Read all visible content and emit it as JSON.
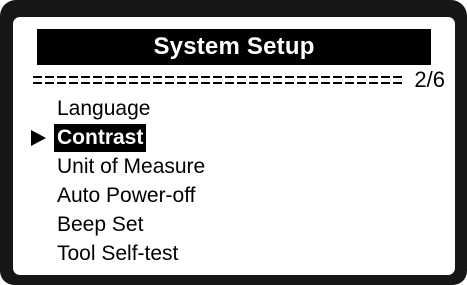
{
  "screen": {
    "title": "System Setup",
    "page_indicator": "2/6"
  },
  "menu": {
    "selected_index": 1,
    "items": [
      {
        "label": "Language"
      },
      {
        "label": "Contrast"
      },
      {
        "label": "Unit of Measure"
      },
      {
        "label": "Auto Power-off"
      },
      {
        "label": "Beep Set"
      },
      {
        "label": "Tool Self-test"
      }
    ]
  },
  "colors": {
    "bezel": "#161616",
    "screen_background": "#ffffff",
    "highlight": "#000000"
  },
  "icons": {
    "selection_cursor": "right-triangle-cursor-icon"
  }
}
